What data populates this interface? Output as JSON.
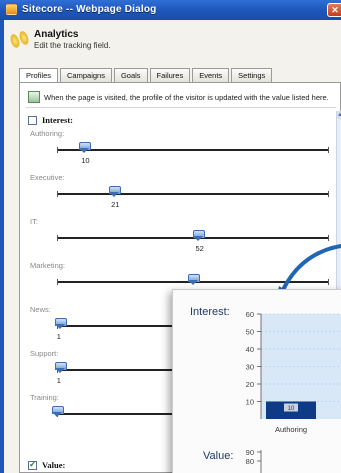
{
  "window": {
    "title": "Sitecore -- Webpage Dialog",
    "close_glyph": "✕"
  },
  "header": {
    "title": "Analytics",
    "subtitle": "Edit the tracking field."
  },
  "tabs": [
    "Profiles",
    "Campaigns",
    "Goals",
    "Failures",
    "Events",
    "Settings"
  ],
  "active_tab": "Profiles",
  "info_text": "When the page is visited, the profile of the visitor is updated with the value listed here.",
  "interest": {
    "label": "Interest:",
    "checked": false,
    "range": [
      0,
      100
    ],
    "sliders": [
      {
        "label": "Authoring:",
        "value": "10",
        "fraction": 0.1
      },
      {
        "label": "Executive:",
        "value": "21",
        "fraction": 0.21
      },
      {
        "label": "IT:",
        "value": "52",
        "fraction": 0.52
      },
      {
        "label": "Marketing:",
        "value": "50",
        "fraction": 0.5
      },
      {
        "label": "News:",
        "value": "1",
        "fraction": 0.01
      },
      {
        "label": "Support:",
        "value": "1",
        "fraction": 0.01
      },
      {
        "label": "Training:",
        "value": "",
        "fraction": 0.0
      }
    ]
  },
  "value_section": {
    "label": "Value:",
    "checked": true
  },
  "overlay": {
    "interest_title": "Interest:",
    "value_title": "Value:",
    "arrow_color": "#1f66b3"
  },
  "chart_data": [
    {
      "type": "bar",
      "title": "Interest:",
      "categories": [
        "Authoring"
      ],
      "values": [
        10
      ],
      "y_ticks": [
        10,
        20,
        30,
        40,
        50,
        60
      ],
      "ylim": [
        0,
        60
      ],
      "grid": true,
      "bar_color": "#0d3b86",
      "plot_background": "#d8e8f7"
    },
    {
      "type": "bar",
      "title": "Value:",
      "categories": [],
      "values": [],
      "y_ticks": [
        80,
        90
      ]
    }
  ]
}
